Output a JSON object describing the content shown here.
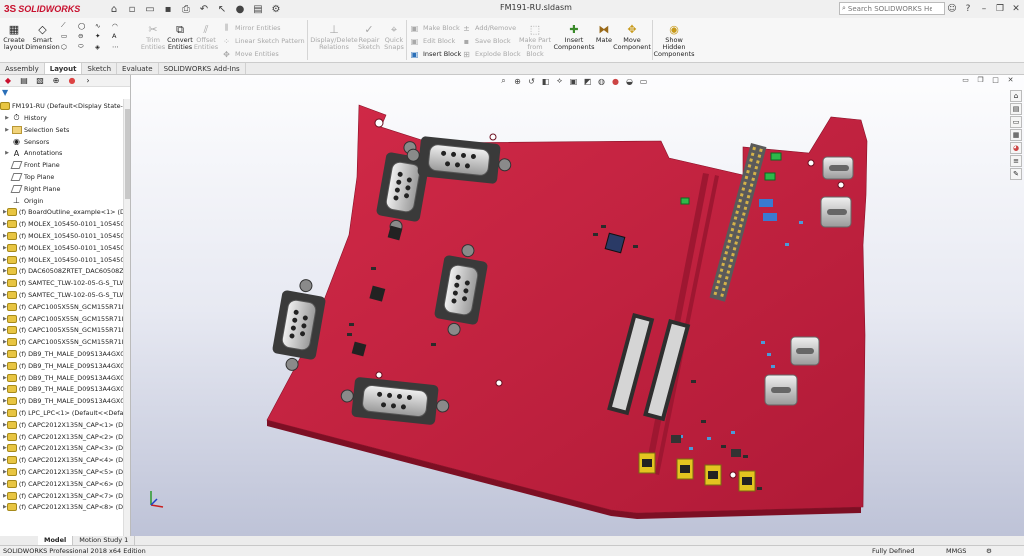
{
  "app": {
    "brand_prefix": "3S",
    "brand_name": "SOLIDWORKS"
  },
  "window": {
    "title": "FM191-RU.sldasm"
  },
  "help_search": {
    "placeholder": "Search SOLIDWORKS Help"
  },
  "ribbon": {
    "create_layout": [
      "Create",
      "layout"
    ],
    "smart_dimension": [
      "Smart",
      "Dimension"
    ],
    "trim_entities": [
      "Trim",
      "Entities"
    ],
    "convert_entities": [
      "Convert",
      "Entities"
    ],
    "offset_entities": [
      "Offset",
      "Entities"
    ],
    "mirror_entities": "Mirror Entities",
    "linear_sketch_pattern": "Linear Sketch Pattern",
    "move_entities": "Move Entities",
    "display_delete_relations": [
      "Display/Delete",
      "Relations"
    ],
    "repair_sketch": [
      "Repair",
      "Sketch"
    ],
    "quick_snaps": [
      "Quick",
      "Snaps"
    ],
    "make_block": "Make Block",
    "edit_block": "Edit Block",
    "insert_block": "Insert Block",
    "add_remove": "Add/Remove",
    "save_block": "Save Block",
    "explode_block": "Explode Block",
    "make_part_from_block": [
      "Make Part",
      "from Block"
    ],
    "insert_components": [
      "Insert",
      "Components"
    ],
    "mate": "Mate",
    "move_component": [
      "Move",
      "Component"
    ],
    "show_hidden_components": [
      "Show",
      "Hidden",
      "Components"
    ]
  },
  "tabs": [
    "Assembly",
    "Layout",
    "Sketch",
    "Evaluate",
    "SOLIDWORKS Add-Ins"
  ],
  "active_tab": "Layout",
  "tree": {
    "root": "FM191-RU  (Default<Display State-1>)",
    "items": [
      {
        "label": "History",
        "icon": "history-icon"
      },
      {
        "label": "Selection Sets",
        "icon": "folder-icon"
      },
      {
        "label": "Sensors",
        "icon": "sensor-icon"
      },
      {
        "label": "Annotations",
        "icon": "annotation-icon"
      },
      {
        "label": "Front Plane",
        "icon": "plane-icon"
      },
      {
        "label": "Top Plane",
        "icon": "plane-icon"
      },
      {
        "label": "Right Plane",
        "icon": "plane-icon"
      },
      {
        "label": "Origin",
        "icon": "origin-icon"
      },
      {
        "label": "(f) BoardOutline_example<1> (Def",
        "icon": "component-icon"
      },
      {
        "label": "(f) MOLEX_105450-0101_105450-01",
        "icon": "component-icon"
      },
      {
        "label": "(f) MOLEX_105450-0101_105450-01",
        "icon": "component-icon"
      },
      {
        "label": "(f) MOLEX_105450-0101_105450-01",
        "icon": "component-icon"
      },
      {
        "label": "(f) MOLEX_105450-0101_105450-01",
        "icon": "component-icon"
      },
      {
        "label": "(f) DAC60508ZRTET_DAC60508ZRT",
        "icon": "component-icon"
      },
      {
        "label": "(f) SAMTEC_TLW-102-05-G-S_TLW",
        "icon": "component-icon"
      },
      {
        "label": "(f) SAMTEC_TLW-102-05-G-S_TLW",
        "icon": "component-icon"
      },
      {
        "label": "(f) CAPC1005X55N_GCM155R71H1",
        "icon": "component-icon"
      },
      {
        "label": "(f) CAPC1005X55N_GCM155R71H1",
        "icon": "component-icon"
      },
      {
        "label": "(f) CAPC1005X55N_GCM155R71H1",
        "icon": "component-icon"
      },
      {
        "label": "(f) CAPC1005X55N_GCM155R71H1",
        "icon": "component-icon"
      },
      {
        "label": "(f) DB9_TH_MALE_D09S13A4GX00L",
        "icon": "component-icon"
      },
      {
        "label": "(f) DB9_TH_MALE_D09S13A4GX00L",
        "icon": "component-icon"
      },
      {
        "label": "(f) DB9_TH_MALE_D09S13A4GX00L",
        "icon": "component-icon"
      },
      {
        "label": "(f) DB9_TH_MALE_D09S13A4GX00L",
        "icon": "component-icon"
      },
      {
        "label": "(f) DB9_TH_MALE_D09S13A4GX00L",
        "icon": "component-icon"
      },
      {
        "label": "(f) LPC_LPC<1> (Default<<Default",
        "icon": "component-icon"
      },
      {
        "label": "(f) CAPC2012X135N_CAP<1> (Def",
        "icon": "component-icon"
      },
      {
        "label": "(f) CAPC2012X135N_CAP<2> (Def",
        "icon": "component-icon"
      },
      {
        "label": "(f) CAPC2012X135N_CAP<3> (Def",
        "icon": "component-icon"
      },
      {
        "label": "(f) CAPC2012X135N_CAP<4> (Def",
        "icon": "component-icon"
      },
      {
        "label": "(f) CAPC2012X135N_CAP<5> (Def",
        "icon": "component-icon"
      },
      {
        "label": "(f) CAPC2012X135N_CAP<6> (Def",
        "icon": "component-icon"
      },
      {
        "label": "(f) CAPC2012X135N_CAP<7> (Def",
        "icon": "component-icon"
      },
      {
        "label": "(f) CAPC2012X135N_CAP<8> (Def",
        "icon": "component-icon"
      }
    ]
  },
  "bottom_tabs": [
    "Model",
    "Motion Study 1"
  ],
  "status": {
    "edition": "SOLIDWORKS Professional 2018 x64 Edition",
    "state": "Fully Defined",
    "units": "MMGS"
  },
  "colors": {
    "brand": "#c8102e",
    "pcb": "#c0213f",
    "pcb_edge": "#7d0f24",
    "connector": "#d2d2d2"
  }
}
